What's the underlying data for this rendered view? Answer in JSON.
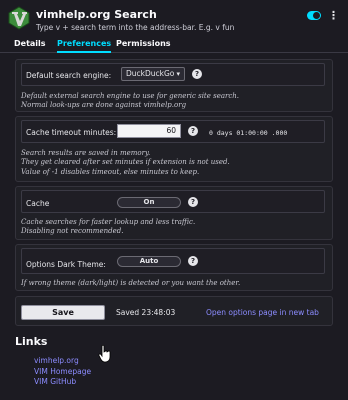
{
  "header": {
    "title": "vimhelp.org Search",
    "description": "Type v + search term into the address-bar. E.g. v fun",
    "enabled": true
  },
  "tabs": [
    {
      "label": "Details",
      "active": false
    },
    {
      "label": "Preferences",
      "active": true
    },
    {
      "label": "Permissions",
      "active": false
    }
  ],
  "engine": {
    "label": "Default search engine:",
    "selected": "DuckDuckGo",
    "help": "Default external search engine to use for generic site search.\nNormal look-ups are done against vimhelp.org"
  },
  "cache_timeout": {
    "label": "Cache timeout minutes:",
    "value": "60",
    "formatted": "0 days 01:00:00 .000",
    "help": "Search results are saved in memory.\nThey get cleared after set minutes if extension is not used.\nValue of -1 disables timeout, else minutes to keep."
  },
  "cache": {
    "label": "Cache",
    "value": "On",
    "help": "Cache searches for faster lookup and less traffic.\nDisabling not recommended."
  },
  "dark_theme": {
    "label": "Options Dark Theme:",
    "value": "Auto",
    "help": "If wrong theme (dark/light) is detected or you want the other."
  },
  "actions": {
    "save_label": "Save",
    "saved_status": "Saved 23:48:03",
    "open_options_link": "Open options page in new tab"
  },
  "links": {
    "title": "Links",
    "items": [
      "vimhelp.org",
      "VIM Homepage",
      "VIM GitHub"
    ]
  },
  "colors": {
    "accent": "#00ddff",
    "link": "#8c8cff",
    "background": "#1c1b22"
  },
  "icons": {
    "extension": "vim-logo-icon",
    "help": "help-circle-icon",
    "more": "more-options-icon"
  }
}
